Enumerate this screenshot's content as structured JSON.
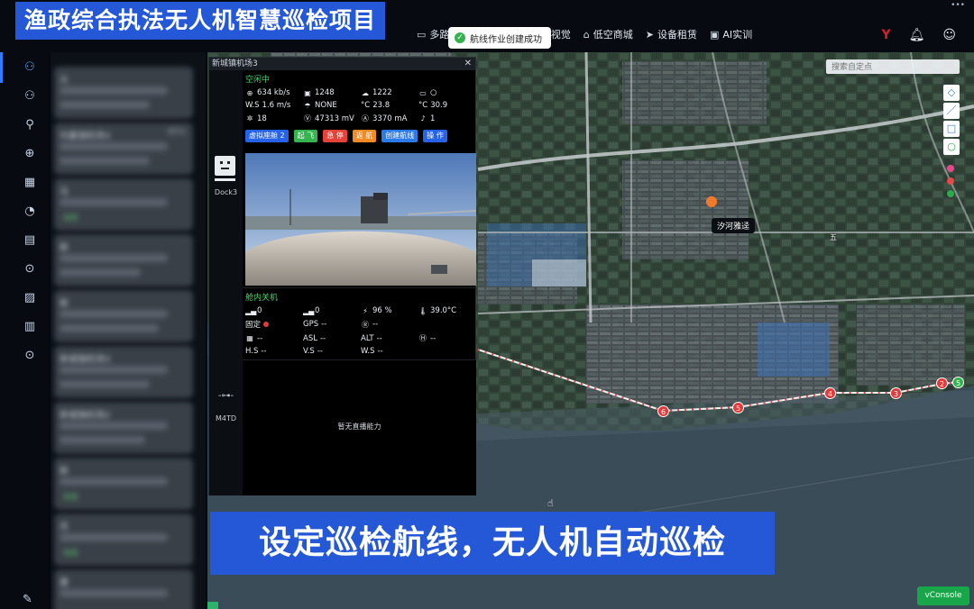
{
  "overlay": {
    "title": "渔政综合执法无人机智慧巡检项目",
    "subtitle": "设定巡检航线，无人机自动巡检"
  },
  "nav": {
    "items": [
      {
        "label": "多路",
        "icon": "video-icon"
      },
      {
        "label": "AI视觉",
        "icon": "eye-icon"
      },
      {
        "label": "低空商城",
        "icon": "shop-icon"
      },
      {
        "label": "设备租赁",
        "icon": "send-icon"
      },
      {
        "label": "AI实训",
        "icon": "training-icon"
      }
    ]
  },
  "toast": {
    "message": "航线作业创建成功"
  },
  "projects": [
    {
      "name": "大",
      "pct": "",
      "status": ""
    },
    {
      "name": "刘巢镇机场3",
      "pct": "85%",
      "status": ""
    },
    {
      "name": "马",
      "pct": "",
      "status": "",
      "tag": "在线"
    },
    {
      "name": "新",
      "pct": "",
      "status": ""
    },
    {
      "name": "新",
      "pct": "",
      "status": ""
    },
    {
      "name": "新城镇机场3",
      "pct": "",
      "status": ""
    },
    {
      "name": "新城镇机场2",
      "pct": "",
      "status": ""
    },
    {
      "name": "新",
      "pct": "",
      "status": "",
      "tag": "在线"
    },
    {
      "name": "月",
      "pct": "",
      "status": "",
      "tag": "在线"
    },
    {
      "name": "惠",
      "pct": "",
      "status": ""
    }
  ],
  "map": {
    "search_placeholder": "搜索自定点",
    "place_label": "汐河雅迳",
    "waypoints": [
      "2",
      "3",
      "4",
      "5",
      "6"
    ],
    "start_label": "5"
  },
  "panel": {
    "title": "新城镇机场3",
    "dock": {
      "name": "Dock3",
      "status": "空闲中",
      "network": "634 kb/s",
      "storage_used": "1248",
      "upload": "1222",
      "wind_speed_label": "W.S",
      "wind_speed": "1.6 m/s",
      "rain": "NONE",
      "temp_label": "°C",
      "temp": "23.8",
      "env_temp_label": "°C",
      "env_temp": "30.9",
      "satellites": "18",
      "voltage": "47313 mV",
      "current": "3370 mA",
      "mic": "1"
    },
    "buttons": [
      "虚拟座舱 2",
      "起 飞",
      "急 停",
      "返 航",
      "创建航线",
      "操 作"
    ],
    "drone": {
      "name": "M4TD",
      "status": "舱内关机",
      "signal1": "0",
      "signal2": "0",
      "battery": "96 %",
      "battery_temp": "39.0°C",
      "fix_label": "固定",
      "gps_label": "GPS",
      "gps": "--",
      "rtk": "--",
      "map_val": "--",
      "asl_label": "ASL",
      "asl": "--",
      "alt_label": "ALT",
      "alt": "--",
      "home": "--",
      "hs_label": "H.S",
      "hs": "--",
      "vs_label": "V.S",
      "vs": "--",
      "ws_label": "W.S",
      "ws": "--",
      "no_live": "暂无直播能力"
    }
  },
  "vconsole": "vConsole"
}
